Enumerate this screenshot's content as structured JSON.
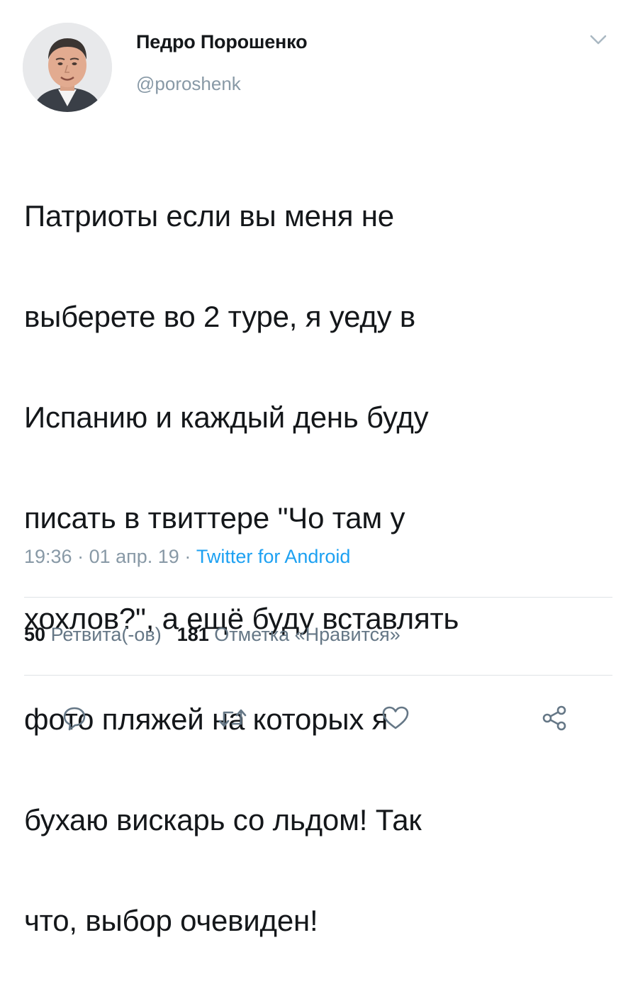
{
  "author": {
    "name": "Педро Порошенко",
    "handle": "@poroshenk"
  },
  "tweet": {
    "lines": [
      "Патриоты если вы меня не",
      "выберете во 2 туре, я уеду в",
      "Испанию и каждый день буду",
      "писать в твиттере \"Чо там у",
      "хохлов?\", а ещё буду вставлять",
      "фото пляжей на которых я",
      "бухаю вискарь со льдом! Так",
      "что, выбор очевиден!"
    ]
  },
  "meta": {
    "time": "19:36",
    "separator": " · ",
    "date": "01 апр. 19",
    "source": "Twitter for Android"
  },
  "stats": {
    "retweets_count": "50",
    "retweets_label": "Ретвита(-ов)",
    "likes_count": "181",
    "likes_label": "Отметка «Нравится»"
  },
  "icons": {
    "menu": "chevron-down-icon",
    "reply": "reply-icon",
    "retweet": "retweet-icon",
    "like": "heart-icon",
    "share": "share-icon"
  },
  "colors": {
    "text": "#14171a",
    "secondary": "#8899a6",
    "link": "#1da1f2",
    "divider": "#dfe3e6",
    "icon": "#657786"
  }
}
